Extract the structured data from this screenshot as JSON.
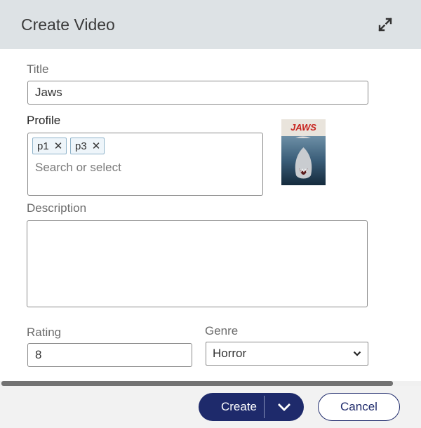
{
  "header": {
    "title": "Create Video",
    "expand_icon": "expand-arrows-icon"
  },
  "form": {
    "title": {
      "label": "Title",
      "value": "Jaws"
    },
    "profile": {
      "label": "Profile",
      "chips": [
        {
          "label": "p1",
          "remove": "✕"
        },
        {
          "label": "p3",
          "remove": "✕"
        }
      ],
      "placeholder": "Search or select"
    },
    "poster": {
      "title_text": "JAWS"
    },
    "description": {
      "label": "Description",
      "value": ""
    },
    "rating": {
      "label": "Rating",
      "value": "8"
    },
    "genre": {
      "label": "Genre",
      "selected": "Horror"
    }
  },
  "footer": {
    "create_label": "Create",
    "cancel_label": "Cancel",
    "accent_color": "#1e2a6b"
  }
}
